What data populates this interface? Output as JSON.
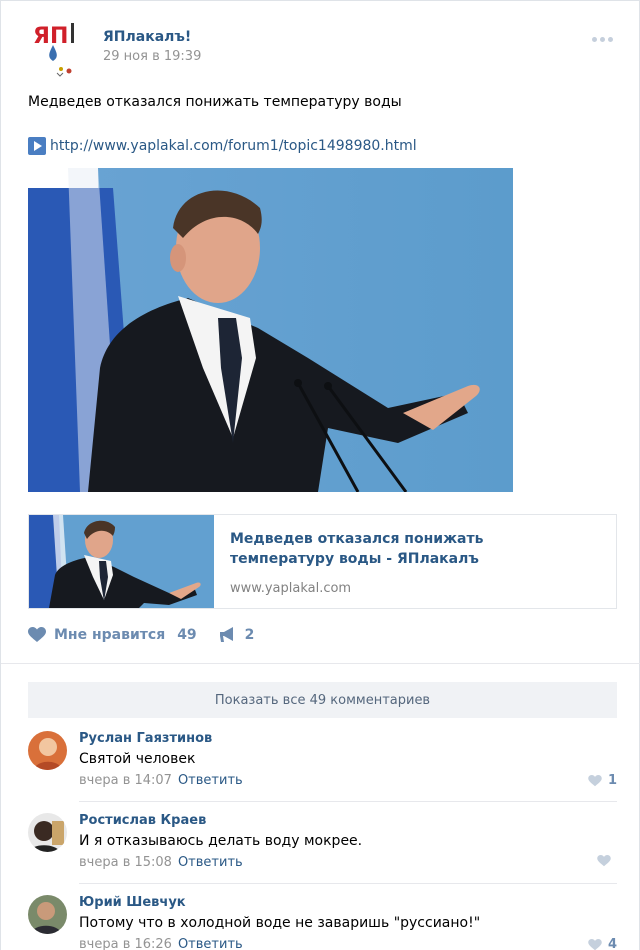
{
  "post": {
    "author": "ЯПлакалъ!",
    "date": "29 ноя в 19:39",
    "logo_text": "ЯП",
    "text": "Медведев отказался понижать температуру воды",
    "link": "http://www.yaplakal.com/forum1/topic1498980.html"
  },
  "snippet": {
    "title": "Медведев отказался понижать температуру воды - ЯПлакалъ",
    "domain": "www.yaplakal.com"
  },
  "actions": {
    "like_label": "Мне нравится",
    "like_count": "49",
    "share_count": "2"
  },
  "comments_header": {
    "show_all": "Показать все 49 комментариев"
  },
  "comments": [
    {
      "author": "Руслан Гаязтинов",
      "text": "Святой человек",
      "time": "вчера в 14:07",
      "reply": "Ответить",
      "likes": "1"
    },
    {
      "author": "Ростислав Краев",
      "text": "И я отказываюсь делать воду мокрее.",
      "time": "вчера в 15:08",
      "reply": "Ответить",
      "likes": ""
    },
    {
      "author": "Юрий Шевчук",
      "text": "Потому что в холодной воде не заваришь \"руссиано!\"",
      "time": "вчера в 16:26",
      "reply": "Ответить",
      "likes": "4"
    }
  ],
  "colors": {
    "link": "#2a5885",
    "action": "#6c8bb0",
    "muted": "#939393"
  }
}
